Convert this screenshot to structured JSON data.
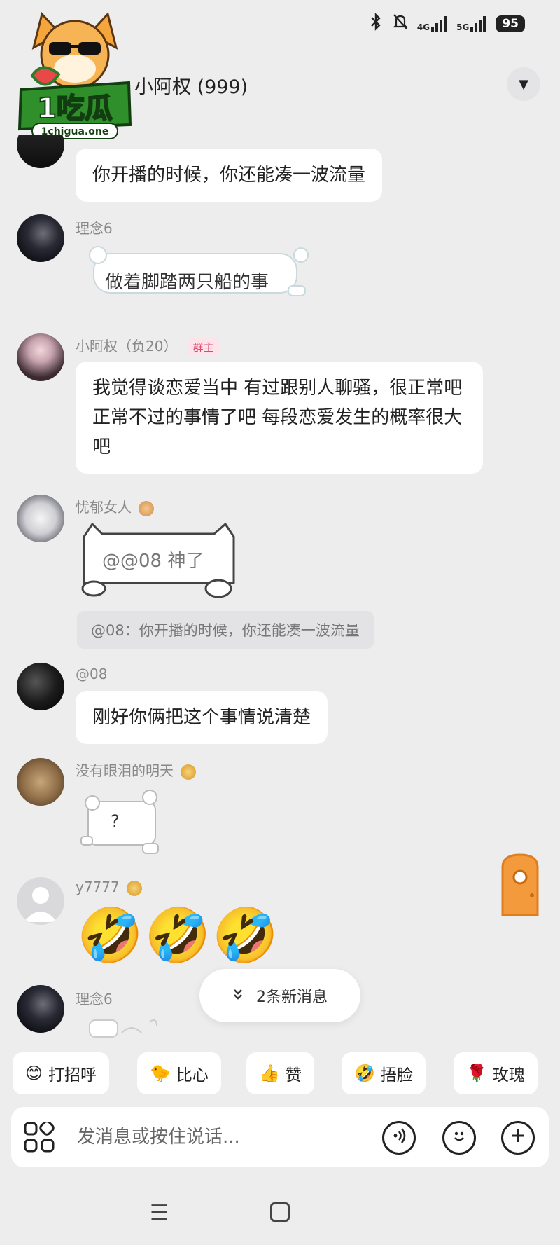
{
  "status": {
    "network_1": "4G",
    "network_2": "5G",
    "battery": "95"
  },
  "logo": {
    "brand": "1吃瓜",
    "domain": "1chigua.one"
  },
  "header": {
    "title": "小阿权 (999)"
  },
  "messages": {
    "m1": {
      "text": "你开播的时候，你还能凑一波流量"
    },
    "m2": {
      "sender": "理念6",
      "sticker_text": "做着脚踏两只船的事"
    },
    "m3": {
      "sender": "小阿权（负20）",
      "role": "群主",
      "text": "我觉得谈恋爱当中 有过跟别人聊骚，很正常吧 正常不过的事情了吧 每段恋爱发生的概率很大吧"
    },
    "m4": {
      "sender": "忧郁女人",
      "sticker_text": "@@08 神了",
      "quote": "@08：你开播的时候，你还能凑一波流量"
    },
    "m5": {
      "sender": "@08",
      "text": "刚好你俩把这个事情说清楚"
    },
    "m6": {
      "sender": "没有眼泪的明天",
      "sticker_text": "?"
    },
    "m7": {
      "sender": "y7777",
      "emojis": "🤣🤣🤣"
    },
    "m8": {
      "sender": "理念6"
    }
  },
  "new_messages": {
    "label": "2条新消息"
  },
  "quick_replies": [
    {
      "emoji": "😊",
      "label": "打招呼"
    },
    {
      "emoji": "🐤",
      "label": "比心"
    },
    {
      "emoji": "👍",
      "label": "赞"
    },
    {
      "emoji": "🤣",
      "label": "捂脸"
    },
    {
      "emoji": "🌹",
      "label": "玫瑰"
    }
  ],
  "input": {
    "placeholder": "发消息或按住说话..."
  },
  "nav": {
    "menu_glyph": "☰"
  },
  "colors": {
    "background": "#ededee",
    "bubble": "#ffffff",
    "role_badge": "#e2486c",
    "floating_widget": "#f39a3c"
  },
  "icons": [
    "bluetooth-icon",
    "mute-icon",
    "signal-icon",
    "dropdown-icon",
    "apps-grid-icon",
    "voice-icon",
    "emoji-icon",
    "plus-icon",
    "double-chevron-icon",
    "menu-icon",
    "home-icon"
  ]
}
